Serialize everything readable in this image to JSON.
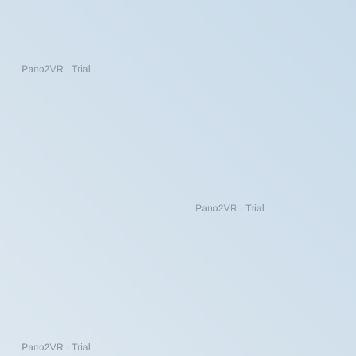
{
  "viewer": {
    "watermarks": [
      "Pano2VR - Trial",
      "Pano2VR - Trial",
      "Pano2VR - Trial"
    ]
  }
}
